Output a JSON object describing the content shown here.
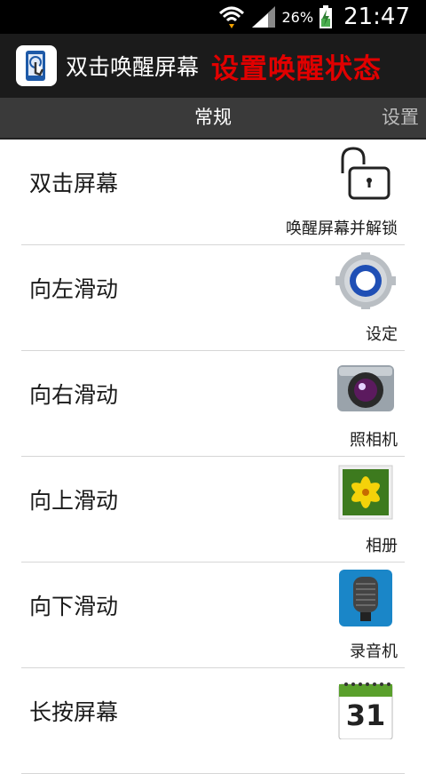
{
  "status_bar": {
    "battery": "26%",
    "time": "21:47"
  },
  "app_bar": {
    "title": "双击唤醒屏幕",
    "subtitle": "设置唤醒状态"
  },
  "tabs": {
    "general": "常规",
    "settings": "设置"
  },
  "rows": [
    {
      "label": "双击屏幕",
      "action": "唤醒屏幕并解锁",
      "icon": "unlock-icon"
    },
    {
      "label": "向左滑动",
      "action": "设定",
      "icon": "settings-gear-icon"
    },
    {
      "label": "向右滑动",
      "action": "照相机",
      "icon": "camera-icon"
    },
    {
      "label": "向上滑动",
      "action": "相册",
      "icon": "gallery-icon"
    },
    {
      "label": "向下滑动",
      "action": "录音机",
      "icon": "voice-recorder-icon"
    },
    {
      "label": "长按屏幕",
      "action": "",
      "icon": "calendar-icon"
    }
  ],
  "calendar_day": "31",
  "colors": {
    "status_bar": "#000000",
    "app_bar": "#1b1b1b",
    "tab_bar": "#3a3a3a",
    "subtitle": "#e10000"
  }
}
